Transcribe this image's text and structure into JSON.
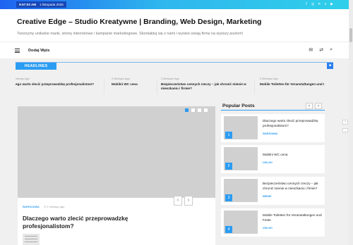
{
  "topbar": {
    "time": "9:57:03 AM",
    "date": "1 listopada 2025",
    "social_icons": [
      "facebook-icon",
      "instagram-icon",
      "x-icon",
      "vk-icon",
      "youtube-icon"
    ]
  },
  "header": {
    "title": "Creative Edge – Studio Kreatywne | Branding, Web Design, Marketing",
    "description": "Tworzymy unikalne marki, strony internetowe i kampanie marketingowe. Skontaktuj się z nami i wynieś swoją firmę na wyższy poziom!"
  },
  "nav": {
    "add_post": "Dodaj Wpis",
    "icons": [
      "mail-icon",
      "shuffle-icon",
      "search-icon"
    ]
  },
  "headlines": {
    "label": "HEADLINES",
    "items": [
      {
        "ago": "miesąc Ago",
        "title": "ego warto zlecić przeprowadzkę profesjonalistom?"
      },
      {
        "ago": "2 Miesiące Ago",
        "title": "Mobilni WC cena"
      },
      {
        "ago": "2 Miesiące Ago",
        "title": "Bezpieczeństwo cennych rzeczy – jak chronić mienie w mieszkaniu i firmie?"
      },
      {
        "ago": "3 Miesiące Ago",
        "title": "Mobile Toiletten für Veranstaltungen und I"
      }
    ]
  },
  "slider": {
    "category": "WARSZAWA",
    "ago": "1 miesiąc ago",
    "title": "Dlaczego warto zlecić przeprowadzkę profesjonalistom?",
    "prev": "‹",
    "next": "›"
  },
  "popular": {
    "title": "Popular Posts",
    "up": "˄",
    "down": "˅",
    "items": [
      {
        "num": "1",
        "title": "Dlaczego warto zlecić przeprowadzkę profesjonalistom?",
        "category": "WARSZAWA"
      },
      {
        "num": "2",
        "title": "Mobilni WC cena",
        "category": "USŁUGI"
      },
      {
        "num": "3",
        "title": "Bezpieczeństwo cennych rzeczy – jak chronić mienie w mieszkaniu i firmie?",
        "category": "MIENIE"
      },
      {
        "num": "4",
        "title": "Mobile Toiletten für Veranstaltungen und Feste",
        "category": "USŁUGI"
      }
    ]
  },
  "colors": {
    "accent": "#2b9cf2",
    "topbar_start": "#1e63f0",
    "topbar_end": "#2fd0ea"
  }
}
